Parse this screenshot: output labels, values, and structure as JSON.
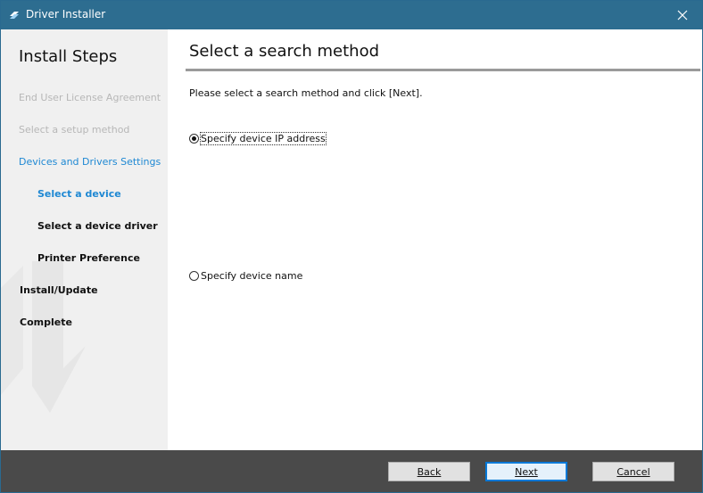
{
  "window": {
    "title": "Driver Installer"
  },
  "sidebar": {
    "heading": "Install Steps",
    "steps": [
      {
        "label": "End User License Agreement",
        "state": "done"
      },
      {
        "label": "Select a setup method",
        "state": "done"
      },
      {
        "label": "Devices and Drivers Settings",
        "state": "active"
      },
      {
        "label": "Select a device",
        "state": "active-sub"
      },
      {
        "label": "Select a device driver",
        "state": "pending-sub"
      },
      {
        "label": "Printer Preference",
        "state": "pending-sub"
      },
      {
        "label": "Install/Update",
        "state": "pending"
      },
      {
        "label": "Complete",
        "state": "pending"
      }
    ]
  },
  "main": {
    "title": "Select a search method",
    "instruction": "Please select a search method and click [Next].",
    "options": [
      {
        "label": "Specify device IP address",
        "selected": true
      },
      {
        "label": "Specify device name",
        "selected": false
      }
    ]
  },
  "footer": {
    "back_label": "Back",
    "next_label": "Next",
    "cancel_label": "Cancel"
  },
  "colors": {
    "titlebar": "#2d6d90",
    "active_step": "#1e88d3",
    "footer": "#4a4a4a",
    "sidebar": "#f0f0f0"
  },
  "icons": {
    "app": "driver-installer-icon",
    "close": "close-icon"
  }
}
